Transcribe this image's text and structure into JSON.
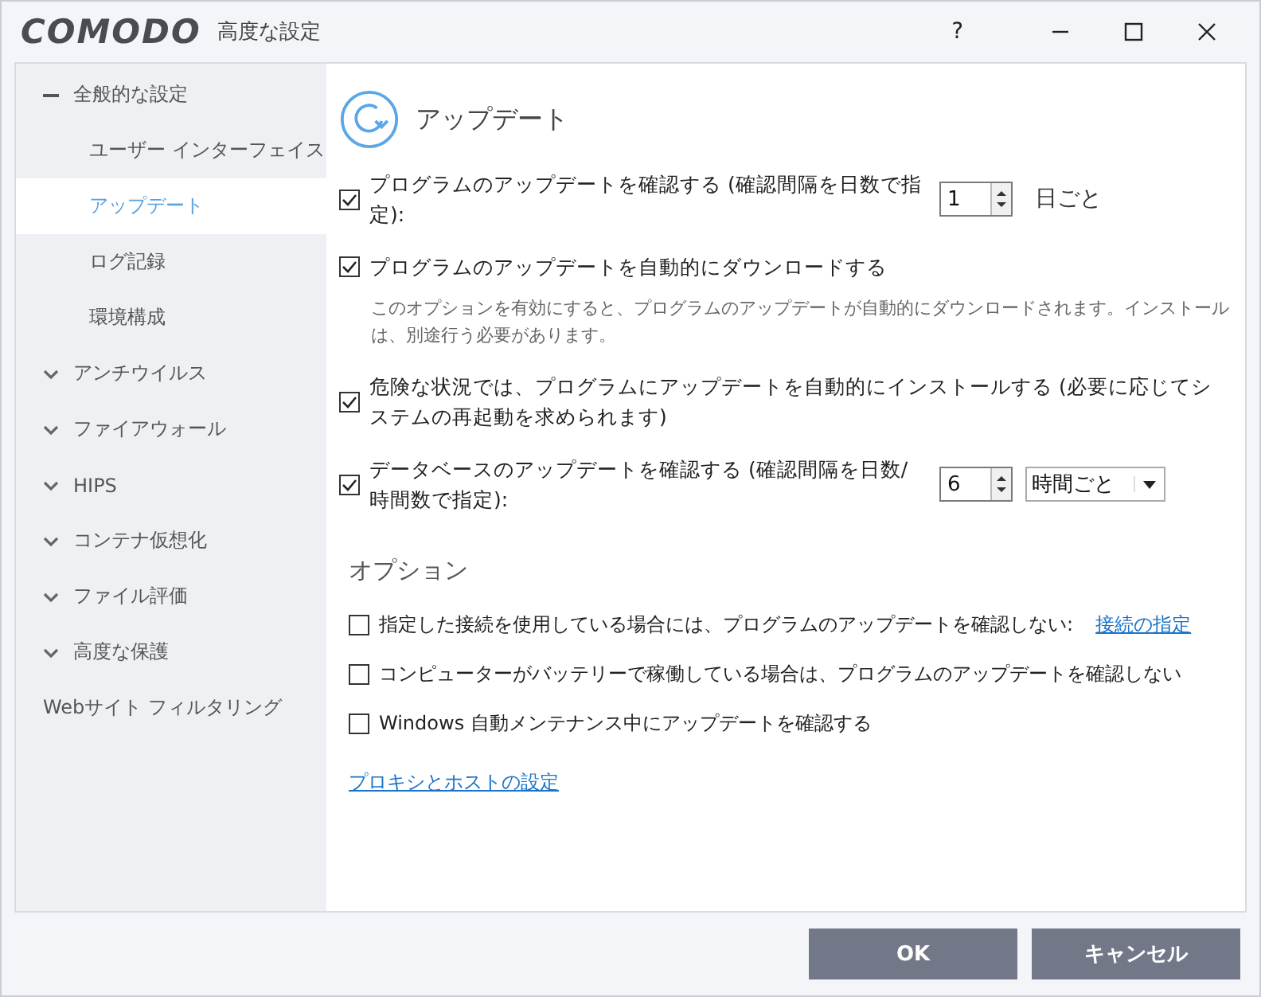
{
  "window": {
    "logo": "COMODO",
    "title": "高度な設定",
    "help": "?"
  },
  "sidebar": {
    "items": [
      {
        "label": "全般的な設定",
        "kind": "group",
        "expanded": true,
        "selected": false,
        "children": [
          {
            "label": "ユーザー インターフェイス",
            "selected": false
          },
          {
            "label": "アップデート",
            "selected": true
          },
          {
            "label": "ログ記録",
            "selected": false
          },
          {
            "label": "環境構成",
            "selected": false
          }
        ]
      },
      {
        "label": "アンチウイルス",
        "kind": "group",
        "expanded": false,
        "selected": false
      },
      {
        "label": "ファイアウォール",
        "kind": "group",
        "expanded": false,
        "selected": false
      },
      {
        "label": "HIPS",
        "kind": "group",
        "expanded": false,
        "selected": false
      },
      {
        "label": "コンテナ仮想化",
        "kind": "group",
        "expanded": false,
        "selected": false
      },
      {
        "label": "ファイル評価",
        "kind": "group",
        "expanded": false,
        "selected": false
      },
      {
        "label": "高度な保護",
        "kind": "group",
        "expanded": false,
        "selected": false
      },
      {
        "label": "Webサイト フィルタリング",
        "kind": "leaf",
        "selected": false
      }
    ]
  },
  "section": {
    "title": "アップデート"
  },
  "settings": [
    {
      "kind": "spinner",
      "checked": true,
      "label": "プログラムのアップデートを確認する (確認間隔を日数で指定):",
      "value": "1",
      "unit": "日ごと"
    },
    {
      "kind": "check",
      "checked": true,
      "label": "プログラムのアップデートを自動的にダウンロードする",
      "note": "このオプションを有効にすると、プログラムのアップデートが自動的にダウンロードされます。インストールは、別途行う必要があります。"
    },
    {
      "kind": "check",
      "checked": true,
      "label": "危険な状況では、プログラムにアップデートを自動的にインストールする (必要に応じてシステムの再起動を求められます)"
    },
    {
      "kind": "spinner-select",
      "checked": true,
      "label": "データベースのアップデートを確認する (確認間隔を日数/時間数で指定):",
      "value": "6",
      "select": "時間ごと"
    }
  ],
  "options": {
    "title": "オプション",
    "items": [
      {
        "checked": false,
        "label": "指定した接続を使用している場合には、プログラムのアップデートを確認しない:",
        "link": "接続の指定"
      },
      {
        "checked": false,
        "label": "コンピューターがバッテリーで稼働している場合は、プログラムのアップデートを確認しない"
      },
      {
        "checked": false,
        "label": "Windows 自動メンテナンス中にアップデートを確認する"
      }
    ]
  },
  "proxy_link": "プロキシとホストの設定",
  "buttons": [
    {
      "label": "OK"
    },
    {
      "label": "キャンセル"
    }
  ]
}
